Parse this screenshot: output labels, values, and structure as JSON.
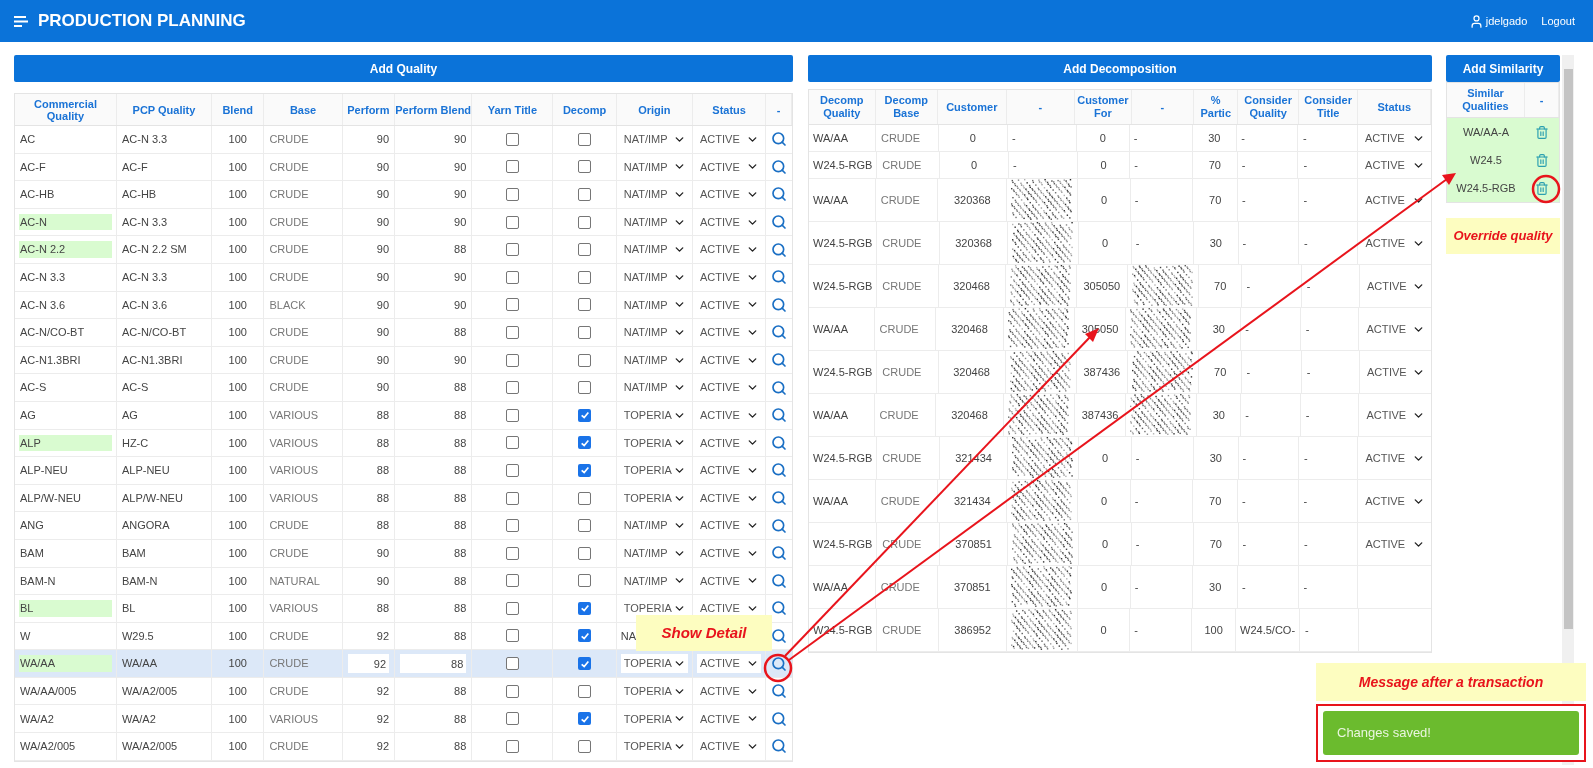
{
  "header": {
    "title": "PRODUCTION PLANNING",
    "user": "jdelgado",
    "logout": "Logout"
  },
  "quality_panel": {
    "button": "Add Quality",
    "columns": [
      "Commercial Quality",
      "PCP Quality",
      "Blend",
      "Base",
      "Perform",
      "Perform Blend",
      "Yarn Title",
      "Decomp",
      "Origin",
      "Status",
      "-"
    ],
    "rows": [
      {
        "commercial_quality": "AC",
        "highlighted": false,
        "pcp_quality": "AC-N 3.3",
        "blend": "100",
        "base": "CRUDE",
        "perform": "90",
        "perform_blend": "90",
        "yarn_title": false,
        "decomp": false,
        "origin": "NAT/IMP",
        "status": "ACTIVE",
        "selected": false,
        "obscured": false
      },
      {
        "commercial_quality": "AC-F",
        "highlighted": false,
        "pcp_quality": "AC-F",
        "blend": "100",
        "base": "CRUDE",
        "perform": "90",
        "perform_blend": "90",
        "yarn_title": false,
        "decomp": false,
        "origin": "NAT/IMP",
        "status": "ACTIVE",
        "selected": false,
        "obscured": false
      },
      {
        "commercial_quality": "AC-HB",
        "highlighted": false,
        "pcp_quality": "AC-HB",
        "blend": "100",
        "base": "CRUDE",
        "perform": "90",
        "perform_blend": "90",
        "yarn_title": false,
        "decomp": false,
        "origin": "NAT/IMP",
        "status": "ACTIVE",
        "selected": false,
        "obscured": false
      },
      {
        "commercial_quality": "AC-N",
        "highlighted": true,
        "pcp_quality": "AC-N 3.3",
        "blend": "100",
        "base": "CRUDE",
        "perform": "90",
        "perform_blend": "90",
        "yarn_title": false,
        "decomp": false,
        "origin": "NAT/IMP",
        "status": "ACTIVE",
        "selected": false,
        "obscured": false
      },
      {
        "commercial_quality": "AC-N 2.2",
        "highlighted": true,
        "pcp_quality": "AC-N 2.2 SM",
        "blend": "100",
        "base": "CRUDE",
        "perform": "90",
        "perform_blend": "88",
        "yarn_title": false,
        "decomp": false,
        "origin": "NAT/IMP",
        "status": "ACTIVE",
        "selected": false,
        "obscured": false
      },
      {
        "commercial_quality": "AC-N 3.3",
        "highlighted": false,
        "pcp_quality": "AC-N 3.3",
        "blend": "100",
        "base": "CRUDE",
        "perform": "90",
        "perform_blend": "90",
        "yarn_title": false,
        "decomp": false,
        "origin": "NAT/IMP",
        "status": "ACTIVE",
        "selected": false,
        "obscured": false
      },
      {
        "commercial_quality": "AC-N 3.6",
        "highlighted": false,
        "pcp_quality": "AC-N 3.6",
        "blend": "100",
        "base": "BLACK",
        "perform": "90",
        "perform_blend": "90",
        "yarn_title": false,
        "decomp": false,
        "origin": "NAT/IMP",
        "status": "ACTIVE",
        "selected": false,
        "obscured": false
      },
      {
        "commercial_quality": "AC-N/CO-BT",
        "highlighted": false,
        "pcp_quality": "AC-N/CO-BT",
        "blend": "100",
        "base": "CRUDE",
        "perform": "90",
        "perform_blend": "88",
        "yarn_title": false,
        "decomp": false,
        "origin": "NAT/IMP",
        "status": "ACTIVE",
        "selected": false,
        "obscured": false
      },
      {
        "commercial_quality": "AC-N1.3BRI",
        "highlighted": false,
        "pcp_quality": "AC-N1.3BRI",
        "blend": "100",
        "base": "CRUDE",
        "perform": "90",
        "perform_blend": "90",
        "yarn_title": false,
        "decomp": false,
        "origin": "NAT/IMP",
        "status": "ACTIVE",
        "selected": false,
        "obscured": false
      },
      {
        "commercial_quality": "AC-S",
        "highlighted": false,
        "pcp_quality": "AC-S",
        "blend": "100",
        "base": "CRUDE",
        "perform": "90",
        "perform_blend": "88",
        "yarn_title": false,
        "decomp": false,
        "origin": "NAT/IMP",
        "status": "ACTIVE",
        "selected": false,
        "obscured": false
      },
      {
        "commercial_quality": "AG",
        "highlighted": false,
        "pcp_quality": "AG",
        "blend": "100",
        "base": "VARIOUS",
        "perform": "88",
        "perform_blend": "88",
        "yarn_title": false,
        "decomp": true,
        "origin": "TOPERIA",
        "status": "ACTIVE",
        "selected": false,
        "obscured": false
      },
      {
        "commercial_quality": "ALP",
        "highlighted": true,
        "pcp_quality": "HZ-C",
        "blend": "100",
        "base": "VARIOUS",
        "perform": "88",
        "perform_blend": "88",
        "yarn_title": false,
        "decomp": true,
        "origin": "TOPERIA",
        "status": "ACTIVE",
        "selected": false,
        "obscured": false
      },
      {
        "commercial_quality": "ALP-NEU",
        "highlighted": false,
        "pcp_quality": "ALP-NEU",
        "blend": "100",
        "base": "VARIOUS",
        "perform": "88",
        "perform_blend": "88",
        "yarn_title": false,
        "decomp": true,
        "origin": "TOPERIA",
        "status": "ACTIVE",
        "selected": false,
        "obscured": false
      },
      {
        "commercial_quality": "ALP/W-NEU",
        "highlighted": false,
        "pcp_quality": "ALP/W-NEU",
        "blend": "100",
        "base": "VARIOUS",
        "perform": "88",
        "perform_blend": "88",
        "yarn_title": false,
        "decomp": false,
        "origin": "TOPERIA",
        "status": "ACTIVE",
        "selected": false,
        "obscured": false
      },
      {
        "commercial_quality": "ANG",
        "highlighted": false,
        "pcp_quality": "ANGORA",
        "blend": "100",
        "base": "CRUDE",
        "perform": "88",
        "perform_blend": "88",
        "yarn_title": false,
        "decomp": false,
        "origin": "NAT/IMP",
        "status": "ACTIVE",
        "selected": false,
        "obscured": false
      },
      {
        "commercial_quality": "BAM",
        "highlighted": false,
        "pcp_quality": "BAM",
        "blend": "100",
        "base": "CRUDE",
        "perform": "90",
        "perform_blend": "88",
        "yarn_title": false,
        "decomp": false,
        "origin": "NAT/IMP",
        "status": "ACTIVE",
        "selected": false,
        "obscured": false
      },
      {
        "commercial_quality": "BAM-N",
        "highlighted": false,
        "pcp_quality": "BAM-N",
        "blend": "100",
        "base": "NATURAL",
        "perform": "90",
        "perform_blend": "88",
        "yarn_title": false,
        "decomp": false,
        "origin": "NAT/IMP",
        "status": "ACTIVE",
        "selected": false,
        "obscured": false
      },
      {
        "commercial_quality": "BL",
        "highlighted": true,
        "pcp_quality": "BL",
        "blend": "100",
        "base": "VARIOUS",
        "perform": "88",
        "perform_blend": "88",
        "yarn_title": false,
        "decomp": true,
        "origin": "TOPERIA",
        "status": "ACTIVE",
        "selected": false,
        "obscured": false
      },
      {
        "commercial_quality": "W",
        "highlighted": false,
        "pcp_quality": "W29.5",
        "blend": "100",
        "base": "CRUDE",
        "perform": "92",
        "perform_blend": "88",
        "yarn_title": false,
        "decomp": true,
        "origin": "NA",
        "selected": false,
        "obscured": true
      },
      {
        "commercial_quality": "WA/AA",
        "highlighted": true,
        "pcp_quality": "WA/AA",
        "blend": "100",
        "base": "CRUDE",
        "perform": "92",
        "perform_blend": "88",
        "yarn_title": false,
        "decomp": true,
        "origin": "TOPERIA",
        "status": "ACTIVE",
        "selected": true,
        "obscured": false
      },
      {
        "commercial_quality": "WA/AA/005",
        "highlighted": false,
        "pcp_quality": "WA/A2/005",
        "blend": "100",
        "base": "CRUDE",
        "perform": "92",
        "perform_blend": "88",
        "yarn_title": false,
        "decomp": false,
        "origin": "TOPERIA",
        "status": "ACTIVE",
        "selected": false,
        "obscured": false
      },
      {
        "commercial_quality": "WA/A2",
        "highlighted": false,
        "pcp_quality": "WA/A2",
        "blend": "100",
        "base": "VARIOUS",
        "perform": "92",
        "perform_blend": "88",
        "yarn_title": false,
        "decomp": true,
        "origin": "TOPERIA",
        "status": "ACTIVE",
        "selected": false,
        "obscured": false
      },
      {
        "commercial_quality": "WA/A2/005",
        "highlighted": false,
        "pcp_quality": "WA/A2/005",
        "blend": "100",
        "base": "CRUDE",
        "perform": "92",
        "perform_blend": "88",
        "yarn_title": false,
        "decomp": false,
        "origin": "TOPERIA",
        "status": "ACTIVE",
        "selected": false,
        "obscured": false
      }
    ]
  },
  "decomposition_panel": {
    "button": "Add Decomposition",
    "columns": [
      "Decomp Quality",
      "Decomp Base",
      "Customer",
      "-",
      "Customer For",
      "-",
      "% Partic",
      "Consider Quality",
      "Consider Title",
      "Status"
    ],
    "rows": [
      {
        "decomp_quality": "WA/AA",
        "decomp_base": "CRUDE",
        "customer": "0",
        "column_4": {
          "kind": "text",
          "text": "-"
        },
        "customer_for": "0",
        "column_6": {
          "kind": "text",
          "text": "-"
        },
        "partic": "30",
        "consider_quality": "-",
        "consider_title": "-",
        "status": "ACTIVE"
      },
      {
        "decomp_quality": "W24.5-RGB",
        "decomp_base": "CRUDE",
        "customer": "0",
        "column_4": {
          "kind": "text",
          "text": "-"
        },
        "customer_for": "0",
        "column_6": {
          "kind": "text",
          "text": "-"
        },
        "partic": "70",
        "consider_quality": "-",
        "consider_title": "-",
        "status": "ACTIVE"
      },
      {
        "decomp_quality": "WA/AA",
        "decomp_base": "CRUDE",
        "customer": "320368",
        "column_4": {
          "kind": "redacted"
        },
        "customer_for": "0",
        "column_6": {
          "kind": "text",
          "text": "-"
        },
        "partic": "70",
        "consider_quality": "-",
        "consider_title": "-",
        "status": "ACTIVE"
      },
      {
        "decomp_quality": "W24.5-RGB",
        "decomp_base": "CRUDE",
        "customer": "320368",
        "column_4": {
          "kind": "redacted"
        },
        "customer_for": "0",
        "column_6": {
          "kind": "text",
          "text": "-"
        },
        "partic": "30",
        "consider_quality": "-",
        "consider_title": "-",
        "status": "ACTIVE"
      },
      {
        "decomp_quality": "W24.5-RGB",
        "decomp_base": "CRUDE",
        "customer": "320468",
        "column_4": {
          "kind": "redacted"
        },
        "customer_for": "305050",
        "column_6": {
          "kind": "redacted"
        },
        "partic": "70",
        "consider_quality": "-",
        "consider_title": "-",
        "status": "ACTIVE"
      },
      {
        "decomp_quality": "WA/AA",
        "decomp_base": "CRUDE",
        "customer": "320468",
        "column_4": {
          "kind": "redacted"
        },
        "customer_for": "305050",
        "column_6": {
          "kind": "redacted"
        },
        "partic": "30",
        "consider_quality": "-",
        "consider_title": "-",
        "status": "ACTIVE"
      },
      {
        "decomp_quality": "W24.5-RGB",
        "decomp_base": "CRUDE",
        "customer": "320468",
        "column_4": {
          "kind": "redacted"
        },
        "customer_for": "387436",
        "column_6": {
          "kind": "redacted"
        },
        "partic": "70",
        "consider_quality": "-",
        "consider_title": "-",
        "status": "ACTIVE"
      },
      {
        "decomp_quality": "WA/AA",
        "decomp_base": "CRUDE",
        "customer": "320468",
        "column_4": {
          "kind": "redacted"
        },
        "customer_for": "387436",
        "column_6": {
          "kind": "redacted"
        },
        "partic": "30",
        "consider_quality": "-",
        "consider_title": "-",
        "status": "ACTIVE"
      },
      {
        "decomp_quality": "W24.5-RGB",
        "decomp_base": "CRUDE",
        "customer": "321434",
        "column_4": {
          "kind": "redacted"
        },
        "customer_for": "0",
        "column_6": {
          "kind": "text",
          "text": "-"
        },
        "partic": "30",
        "consider_quality": "-",
        "consider_title": "-",
        "status": "ACTIVE"
      },
      {
        "decomp_quality": "WA/AA",
        "decomp_base": "CRUDE",
        "customer": "321434",
        "column_4": {
          "kind": "redacted"
        },
        "customer_for": "0",
        "column_6": {
          "kind": "text",
          "text": "-"
        },
        "partic": "70",
        "consider_quality": "-",
        "consider_title": "-",
        "status": "ACTIVE"
      },
      {
        "decomp_quality": "W24.5-RGB",
        "decomp_base": "CRUDE",
        "customer": "370851",
        "column_4": {
          "kind": "redacted"
        },
        "customer_for": "0",
        "column_6": {
          "kind": "text",
          "text": "-"
        },
        "partic": "70",
        "consider_quality": "-",
        "consider_title": "-",
        "status": "ACTIVE"
      },
      {
        "decomp_quality": "WA/AA",
        "decomp_base": "CRUDE",
        "customer": "370851",
        "column_4": {
          "kind": "redacted"
        },
        "customer_for": "0",
        "column_6": {
          "kind": "text",
          "text": "-"
        },
        "partic": "30",
        "consider_quality": "-",
        "consider_title": "-"
      },
      {
        "decomp_quality": "W24.5-RGB",
        "decomp_base": "CRUDE",
        "customer": "386952",
        "column_4": {
          "kind": "redacted"
        },
        "customer_for": "0",
        "column_6": {
          "kind": "text",
          "text": "-"
        },
        "partic": "100",
        "consider_quality": "W24.5/CO-",
        "consider_title": "-"
      }
    ]
  },
  "similarity_panel": {
    "button": "Add Similarity",
    "columns": [
      "Similar Qualities",
      "-"
    ],
    "rows": [
      {
        "quality": "WA/AA-A"
      },
      {
        "quality": "W24.5"
      },
      {
        "quality": "W24.5-RGB"
      }
    ]
  },
  "notes": {
    "show_detail": "Show Detail",
    "override": "Override quality",
    "message": "Message after a transaction"
  },
  "toast": {
    "message": "Changes saved!"
  }
}
